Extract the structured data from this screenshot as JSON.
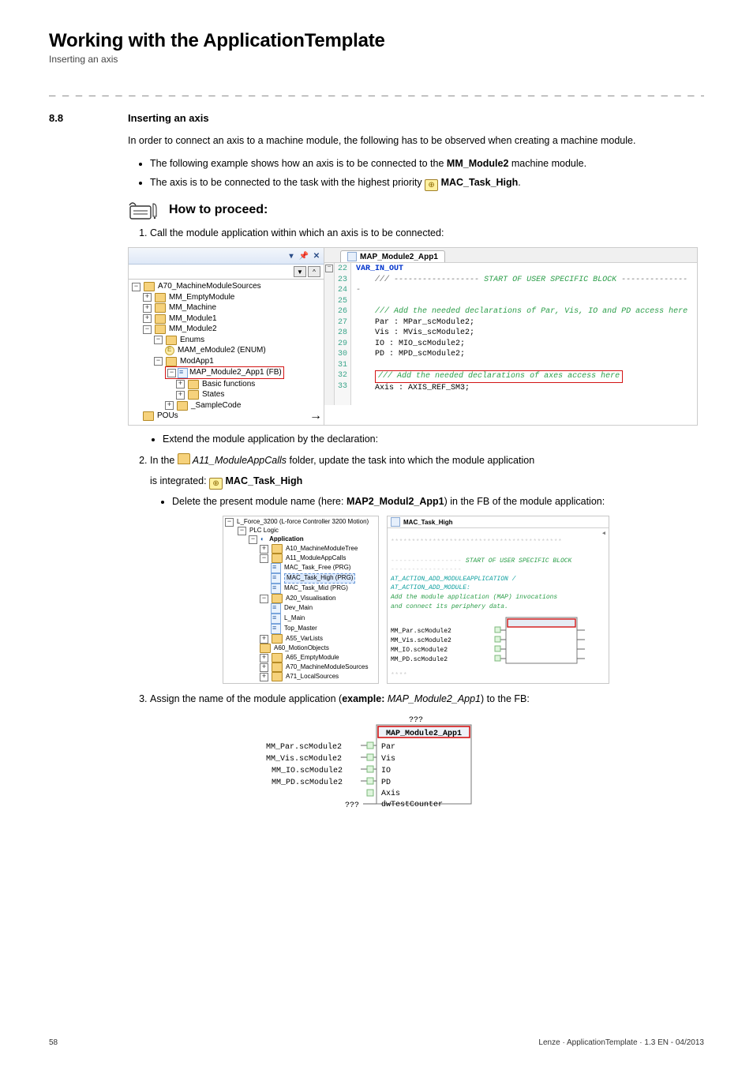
{
  "header": {
    "title": "Working with the ApplicationTemplate",
    "subtitle": "Inserting an axis",
    "separator": "_ _ _ _ _ _ _ _ _ _ _ _ _ _ _ _ _ _ _ _ _ _ _ _ _ _ _ _ _ _ _ _ _ _ _ _ _ _ _ _ _ _ _ _ _ _ _ _ _ _ _ _ _ _ _ _ _ _ _ _ _ _ _ _"
  },
  "section": {
    "num": "8.8",
    "title": "Inserting an axis",
    "intro": "In order to connect an axis to a machine module, the following has to be observed when creating a machine module.",
    "b1a": "The following example shows how an axis is to be connected to the ",
    "b1_mm": "MM_Module2",
    "b1b": " machine module.",
    "b2a": "The axis is to be connected to the task with the highest priority ",
    "b2_task": " MAC_Task_High",
    "b2b": ".",
    "proceed": "How to proceed:",
    "s1": "Call the module application within which an axis is to be connected:",
    "s1_ext": "Extend the module application by the declaration:",
    "s2a": "In the ",
    "s2_folder": " A11_ModuleAppCalls",
    "s2b": " folder, update the task into which the module application",
    "s2c": "is integrated: ",
    "s2_task": " MAC_Task_High",
    "s2_del_a": "Delete the present module name (here: ",
    "s2_del_b": "MAP2_Modul2_App1",
    "s2_del_c": ") in the FB of the module application:",
    "s3a": "Assign the name of the module application (",
    "s3_ex_label": "example:",
    "s3_ex_val": " MAP_Module2_App1",
    "s3b": ") to the FB:"
  },
  "shot1": {
    "tab": "MAP_Module2_App1",
    "tree": {
      "a70": "A70_MachineModuleSources",
      "empty": "MM_EmptyModule",
      "machine": "MM_Machine",
      "mod1": "MM_Module1",
      "mod2": "MM_Module2",
      "enums": "Enums",
      "enum_item": "MAM_eModule2 (ENUM)",
      "modapp1": "ModApp1",
      "map_fb": "MAP_Module2_App1 (FB)",
      "basic": "Basic functions",
      "states": "States",
      "sample": "_SampleCode",
      "pous": "POUs"
    },
    "code": {
      "lines": [
        "22",
        "23",
        "24",
        "25",
        "26",
        "27",
        "28",
        "29",
        "30",
        "31",
        "32",
        "33"
      ],
      "var": "VAR_IN_OUT",
      "start_cmt": " START OF USER SPECIFIC BLOCK ",
      "add_decl": "/// Add the needed declarations of Par, Vis, IO and PD access here",
      "par": "Par     : MPar_scModule2;",
      "vis": "Vis     : MVis_scModule2;",
      "io": "IO      : MIO_scModule2;",
      "pd": "PD      : MPD_scModule2;",
      "axes_cmt": "/// Add the needed declarations of axes access here",
      "axis": "Axis    : AXIS_REF_SM3;"
    }
  },
  "shot2": {
    "tab": "MAC_Task_High",
    "tree": {
      "root": "L_Force_3200 (L-force Controller 3200 Motion)",
      "plc": "PLC Logic",
      "app": "Application",
      "a10": "A10_MachineModuleTree",
      "a11": "A11_ModuleAppCalls",
      "free": "MAC_Task_Free (PRG)",
      "high": "MAC_Task_High (PRG)",
      "mid": "MAC_Task_Mid (PRG)",
      "a20": "A20_Visualisation",
      "devmain": "Dev_Main",
      "lmain": "L_Main",
      "top": "Top_Master",
      "a55": "A55_VarLists",
      "a60": "A60_MotionObjects",
      "a65": "A65_EmptyModule",
      "a70": "A70_MachineModuleSources",
      "a71": "A71_LocalSources"
    },
    "code": {
      "sep": "*****************************************",
      "dash": "-----------------",
      "start": " START OF USER SPECIFIC BLOCK",
      "at1": "AT_ACTION_ADD_MODULEAPPLICATION /",
      "at2": "AT_ACTION_ADD_MODULE:",
      "cmt1": "Add the module application (MAP) invocations",
      "cmt2": "and connect its periphery data.",
      "par": "MM_Par.scModule2",
      "vis": "MM_Vis.scModule2",
      "io": "MM_IO.scModule2",
      "pd": "MM_PD.scModule2"
    }
  },
  "shot3": {
    "title": "MAP_Module2_App1",
    "q": "???",
    "rows": {
      "par": "MM_Par.scModule2",
      "vis": "MM_Vis.scModule2",
      "io": "MM_IO.scModule2",
      "pd": "MM_PD.scModule2"
    },
    "ports": {
      "par": "Par",
      "vis": "Vis",
      "io": "IO",
      "pd": "PD",
      "axis": "Axis",
      "tc": "dwTestCounter"
    }
  },
  "footer": {
    "page": "58",
    "stamp": "Lenze · ApplicationTemplate · 1.3 EN - 04/2013"
  }
}
